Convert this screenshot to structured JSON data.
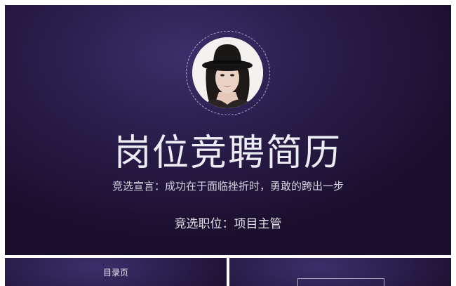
{
  "main_slide": {
    "title": "岗位竞聘简历",
    "motto": "竞选宣言：成功在于面临挫折时，勇敢的跨出一步",
    "position": "竞选职位：项目主管"
  },
  "thumbnails": [
    {
      "label": "目录页"
    },
    {
      "label": ""
    }
  ]
}
